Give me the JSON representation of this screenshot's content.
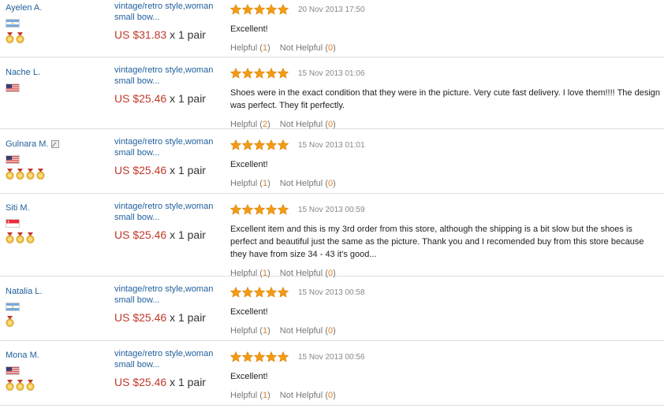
{
  "colors": {
    "link": "#1f5f9c",
    "price": "#c0392b",
    "star": "#f39c12",
    "count": "#e67e22",
    "divider": "#dcdcdc"
  },
  "reviews": [
    {
      "buyer": "Ayelen A.",
      "flag": "argentina",
      "medals": 2,
      "badge_icon": false,
      "product": "vintage/retro style,woman small bow...",
      "price": "US $31.83",
      "qty": "x 1 pair",
      "stars": 5,
      "date": "20 Nov 2013 17:50",
      "feedback": "Excellent!",
      "helpful_label": "Helpful",
      "helpful_count": "1",
      "not_helpful_label": "Not Helpful",
      "not_helpful_count": "0"
    },
    {
      "buyer": "Nache L.",
      "flag": "usa",
      "medals": 0,
      "badge_icon": false,
      "product": "vintage/retro style,woman small bow...",
      "price": "US $25.46",
      "qty": "x 1 pair",
      "stars": 5,
      "date": "15 Nov 2013 01:06",
      "feedback": "Shoes were in the exact condition that they were in the picture. Very cute fast delivery. I love them!!!! The design was perfect. They fit perfectly.",
      "helpful_label": "Helpful",
      "helpful_count": "2",
      "not_helpful_label": "Not Helpful",
      "not_helpful_count": "0"
    },
    {
      "buyer": "Gulnara M.",
      "flag": "usa",
      "medals": 4,
      "badge_icon": true,
      "product": "vintage/retro style,woman small bow...",
      "price": "US $25.46",
      "qty": "x 1 pair",
      "stars": 5,
      "date": "15 Nov 2013 01:01",
      "feedback": "Excellent!",
      "helpful_label": "Helpful",
      "helpful_count": "1",
      "not_helpful_label": "Not Helpful",
      "not_helpful_count": "0"
    },
    {
      "buyer": "Siti M.",
      "flag": "singapore",
      "medals": 3,
      "badge_icon": false,
      "product": "vintage/retro style,woman small bow...",
      "price": "US $25.46",
      "qty": "x 1 pair",
      "stars": 5,
      "date": "15 Nov 2013 00:59",
      "feedback": "Excellent item and this is my 3rd order from this store, although the shipping is a bit slow but the shoes is perfect and beautiful just the same as the picture. Thank you and I recomended buy from this store because they have from size 34 - 43 it's good...",
      "helpful_label": "Helpful",
      "helpful_count": "1",
      "not_helpful_label": "Not Helpful",
      "not_helpful_count": "0"
    },
    {
      "buyer": "Natalia L.",
      "flag": "argentina",
      "medals": 1,
      "badge_icon": false,
      "product": "vintage/retro style,woman small bow...",
      "price": "US $25.46",
      "qty": "x 1 pair",
      "stars": 5,
      "date": "15 Nov 2013 00:58",
      "feedback": "Excellent!",
      "helpful_label": "Helpful",
      "helpful_count": "1",
      "not_helpful_label": "Not Helpful",
      "not_helpful_count": "0"
    },
    {
      "buyer": "Mona M.",
      "flag": "usa",
      "medals": 3,
      "badge_icon": false,
      "product": "vintage/retro style,woman small bow...",
      "price": "US $25.46",
      "qty": "x 1 pair",
      "stars": 5,
      "date": "15 Nov 2013 00:56",
      "feedback": "Excellent!",
      "helpful_label": "Helpful",
      "helpful_count": "1",
      "not_helpful_label": "Not Helpful",
      "not_helpful_count": "0"
    }
  ]
}
